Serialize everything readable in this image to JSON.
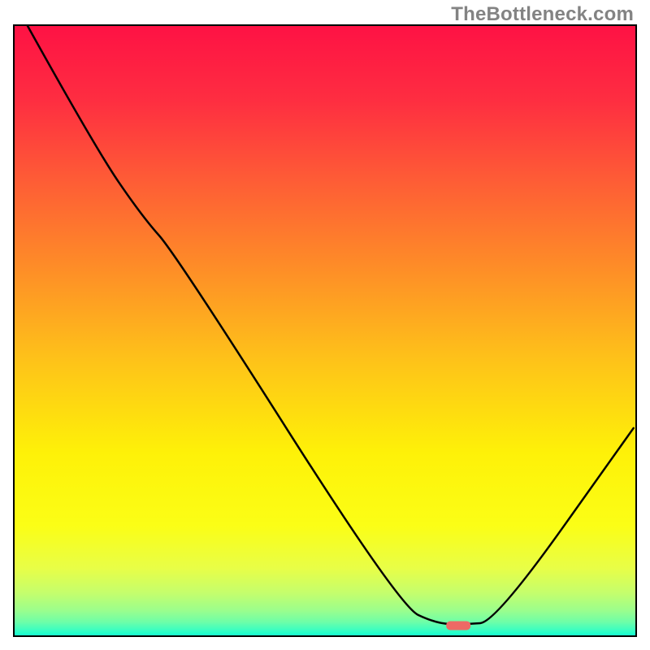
{
  "attribution": "TheBottleneck.com",
  "chart_data": {
    "type": "line",
    "title": "",
    "xlabel": "",
    "ylabel": "",
    "xlim": [
      0,
      100
    ],
    "ylim": [
      0,
      100
    ],
    "series": [
      {
        "name": "curve",
        "x": [
          2.1,
          13.0,
          20.5,
          26.0,
          62.0,
          68.0,
          72.5,
          77.5,
          99.7
        ],
        "y": [
          100.0,
          80.0,
          68.8,
          62.5,
          4.8,
          1.9,
          1.8,
          2.2,
          34.0
        ]
      }
    ],
    "marker": {
      "x": 71.5,
      "y": 1.6
    },
    "background": {
      "stops": [
        {
          "offset": 0.0,
          "color": "#fe1244"
        },
        {
          "offset": 0.12,
          "color": "#fe2d41"
        },
        {
          "offset": 0.25,
          "color": "#fe5b36"
        },
        {
          "offset": 0.4,
          "color": "#fe8e27"
        },
        {
          "offset": 0.55,
          "color": "#fec319"
        },
        {
          "offset": 0.7,
          "color": "#fef108"
        },
        {
          "offset": 0.82,
          "color": "#fbfe16"
        },
        {
          "offset": 0.89,
          "color": "#e8fe47"
        },
        {
          "offset": 0.93,
          "color": "#c5fe6c"
        },
        {
          "offset": 0.958,
          "color": "#9dfe8b"
        },
        {
          "offset": 0.978,
          "color": "#6efea8"
        },
        {
          "offset": 0.99,
          "color": "#40febf"
        },
        {
          "offset": 1.0,
          "color": "#15fed0"
        }
      ]
    },
    "marker_color": "#ed6965"
  }
}
